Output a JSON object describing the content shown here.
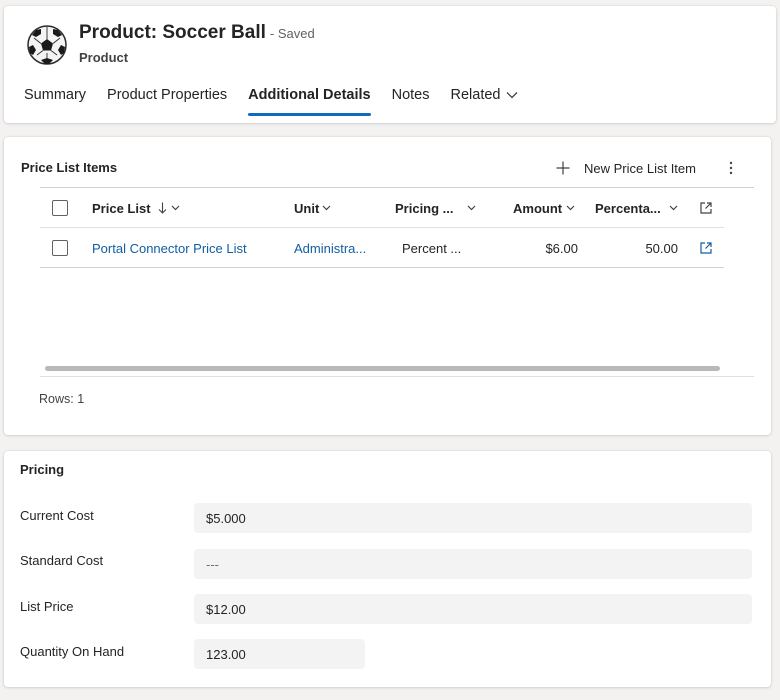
{
  "header": {
    "title": "Product: Soccer Ball",
    "saved_status": "- Saved",
    "entity_type": "Product",
    "avatar_icon": "soccer-ball-icon",
    "tabs": [
      {
        "label": "Summary",
        "active": false
      },
      {
        "label": "Product Properties",
        "active": false
      },
      {
        "label": "Additional Details",
        "active": true
      },
      {
        "label": "Notes",
        "active": false
      },
      {
        "label": "Related",
        "active": false
      }
    ]
  },
  "price_list_items": {
    "title": "Price List Items",
    "new_button_label": "New Price List Item",
    "columns": [
      "Price List",
      "Unit",
      "Pricing ...",
      "Amount",
      "Percenta..."
    ],
    "rows": [
      {
        "price_list": "Portal Connector Price List",
        "unit": "Administra...",
        "pricing": "Percent ...",
        "amount": "$6.00",
        "percentage": "50.00"
      }
    ],
    "rows_label": "Rows: 1"
  },
  "pricing": {
    "title": "Pricing",
    "fields": [
      {
        "label": "Current Cost",
        "value": "$5.000"
      },
      {
        "label": "Standard Cost",
        "value": "---"
      },
      {
        "label": "List Price",
        "value": "$12.00"
      },
      {
        "label": "Quantity On Hand",
        "value": "123.00"
      }
    ]
  },
  "colors": {
    "accent": "#0f6cbd",
    "link": "#115ea3",
    "background": "#f3f2f1"
  }
}
